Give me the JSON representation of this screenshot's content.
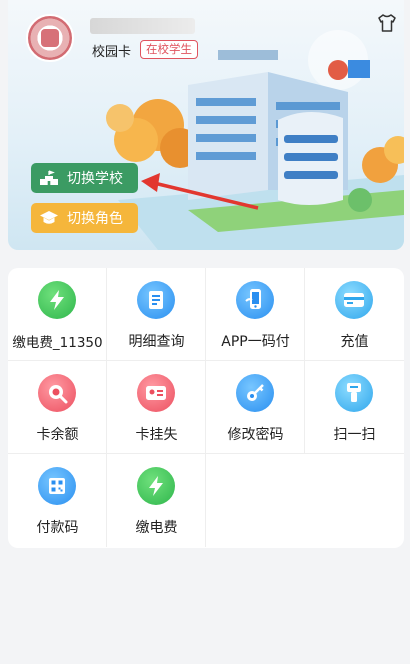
{
  "profile": {
    "card_type": "校园卡",
    "status_badge": "在校学生"
  },
  "actions": {
    "switch_school": "切换学校",
    "switch_role": "切换角色"
  },
  "grid": [
    {
      "label": "缴电费_11350",
      "icon": "lightning-icon"
    },
    {
      "label": "明细查询",
      "icon": "document-list-icon"
    },
    {
      "label": "APP一码付",
      "icon": "phone-pay-icon"
    },
    {
      "label": "充值",
      "icon": "card-recharge-icon"
    },
    {
      "label": "卡余额",
      "icon": "magnifier-coin-icon"
    },
    {
      "label": "卡挂失",
      "icon": "id-card-icon"
    },
    {
      "label": "修改密码",
      "icon": "key-icon"
    },
    {
      "label": "扫一扫",
      "icon": "scanner-icon"
    },
    {
      "label": "付款码",
      "icon": "qr-code-icon"
    },
    {
      "label": "缴电费",
      "icon": "lightning-icon"
    }
  ],
  "colors": {
    "switch_school_bg": "#3b9b63",
    "switch_role_bg": "#f5b63b",
    "badge": "#e0545f",
    "annotation_arrow": "#e2372f"
  }
}
